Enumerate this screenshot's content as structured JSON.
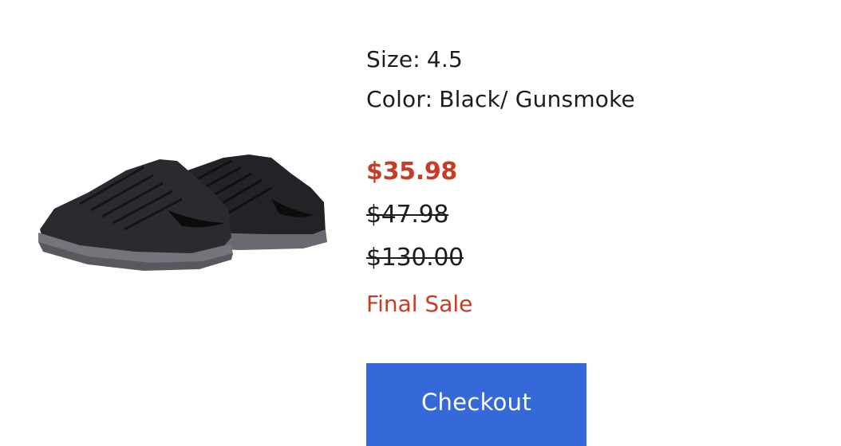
{
  "product": {
    "image_name": "black-gunsmoke-training-sneakers",
    "size_label": "Size:",
    "size_value": "4.5",
    "color_label": "Color:",
    "color_value": "Black/ Gunsmoke"
  },
  "pricing": {
    "sale_price": "$35.98",
    "previous_price": "$47.98",
    "original_price": "$130.00",
    "final_sale_text": "Final Sale"
  },
  "actions": {
    "checkout_label": "Checkout"
  },
  "colors": {
    "sale_red": "#c53d24",
    "button_blue": "#3568d8",
    "text_dark": "#1d1d1d"
  }
}
